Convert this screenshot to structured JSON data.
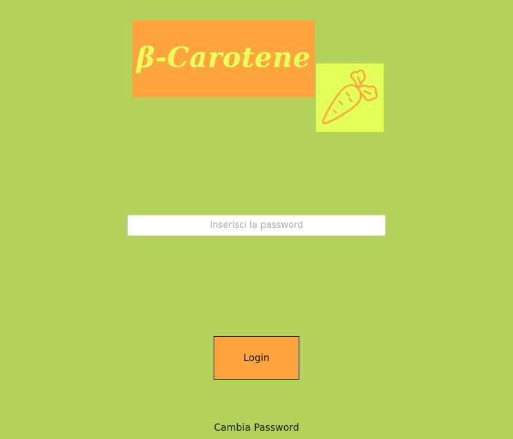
{
  "app": {
    "logo_text": "β-Carotene",
    "logo_icon": "carrot-icon"
  },
  "login_form": {
    "password_placeholder": "Inserisci la password",
    "password_value": "",
    "login_label": "Login",
    "change_password_label": "Cambia Password"
  },
  "colors": {
    "background": "#b3d35a",
    "accent_orange": "#ffa43e",
    "accent_yellow": "#e2ff58",
    "logo_text": "#e8ff5a"
  }
}
